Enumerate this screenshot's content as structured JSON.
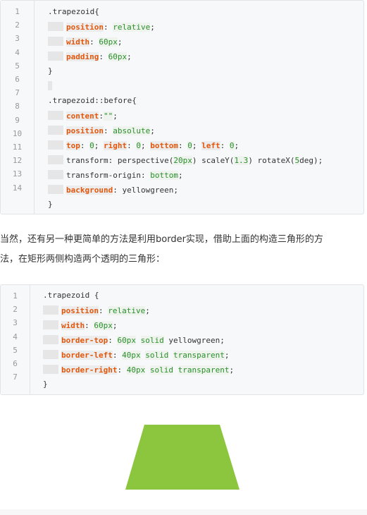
{
  "block1": {
    "line_numbers": [
      "1",
      "2",
      "3",
      "4",
      "5",
      "6",
      "7",
      "8",
      "9",
      "10",
      "11",
      "12",
      "13",
      "14"
    ],
    "lines": [
      [
        {
          "t": "plain",
          "v": ".trapezoid{"
        }
      ],
      [
        {
          "t": "prop",
          "v": "position"
        },
        {
          "t": "plain",
          "v": ": "
        },
        {
          "t": "val",
          "v": "relative"
        },
        {
          "t": "plain",
          "v": ";"
        }
      ],
      [
        {
          "t": "prop",
          "v": "width"
        },
        {
          "t": "plain",
          "v": ": "
        },
        {
          "t": "val",
          "v": "60px"
        },
        {
          "t": "plain",
          "v": ";"
        }
      ],
      [
        {
          "t": "prop",
          "v": "padding"
        },
        {
          "t": "plain",
          "v": ": "
        },
        {
          "t": "val",
          "v": "60px"
        },
        {
          "t": "plain",
          "v": ";"
        }
      ],
      [
        {
          "t": "plain",
          "v": "}"
        }
      ],
      [],
      [
        {
          "t": "plain",
          "v": ".trapezoid::before{"
        }
      ],
      [
        {
          "t": "prop",
          "v": "content"
        },
        {
          "t": "plain",
          "v": ":"
        },
        {
          "t": "val",
          "v": "\"\""
        },
        {
          "t": "plain",
          "v": ";"
        }
      ],
      [
        {
          "t": "prop",
          "v": "position"
        },
        {
          "t": "plain",
          "v": ": "
        },
        {
          "t": "val",
          "v": "absolute"
        },
        {
          "t": "plain",
          "v": ";"
        }
      ],
      [
        {
          "t": "prop",
          "v": "top"
        },
        {
          "t": "plain",
          "v": ": "
        },
        {
          "t": "val",
          "v": "0"
        },
        {
          "t": "plain",
          "v": "; "
        },
        {
          "t": "prop",
          "v": "right"
        },
        {
          "t": "plain",
          "v": ": "
        },
        {
          "t": "val",
          "v": "0"
        },
        {
          "t": "plain",
          "v": "; "
        },
        {
          "t": "prop",
          "v": "bottom"
        },
        {
          "t": "plain",
          "v": ": "
        },
        {
          "t": "val",
          "v": "0"
        },
        {
          "t": "plain",
          "v": "; "
        },
        {
          "t": "prop",
          "v": "left"
        },
        {
          "t": "plain",
          "v": ": "
        },
        {
          "t": "val",
          "v": "0"
        },
        {
          "t": "plain",
          "v": ";"
        }
      ],
      [
        {
          "t": "plain",
          "v": "transform: perspective("
        },
        {
          "t": "val",
          "v": "20px"
        },
        {
          "t": "plain",
          "v": ") scaleY("
        },
        {
          "t": "val",
          "v": "1.3"
        },
        {
          "t": "plain",
          "v": ") rotateX("
        },
        {
          "t": "val",
          "v": "5"
        },
        {
          "t": "plain",
          "v": "deg);"
        }
      ],
      [
        {
          "t": "plain",
          "v": "transform-origin: "
        },
        {
          "t": "val",
          "v": "bottom"
        },
        {
          "t": "plain",
          "v": ";"
        }
      ],
      [
        {
          "t": "prop",
          "v": "background"
        },
        {
          "t": "plain",
          "v": ": yellowgreen;"
        }
      ],
      [
        {
          "t": "plain",
          "v": "}"
        }
      ]
    ],
    "indented": [
      false,
      true,
      true,
      true,
      false,
      false,
      false,
      true,
      true,
      true,
      true,
      true,
      true,
      false
    ]
  },
  "paragraph": {
    "line1": "当然，还有另一种更简单的方法是利用border实现，借助上面的构造三角形的方",
    "line2": "法，在矩形两侧构造两个透明的三角形："
  },
  "block2": {
    "line_numbers": [
      "1",
      "2",
      "3",
      "4",
      "5",
      "6",
      "7"
    ],
    "lines": [
      [
        {
          "t": "plain",
          "v": ".trapezoid {"
        }
      ],
      [
        {
          "t": "prop",
          "v": "position"
        },
        {
          "t": "plain",
          "v": ": "
        },
        {
          "t": "val",
          "v": "relative"
        },
        {
          "t": "plain",
          "v": ";"
        }
      ],
      [
        {
          "t": "prop",
          "v": "width"
        },
        {
          "t": "plain",
          "v": ": "
        },
        {
          "t": "val",
          "v": "60px"
        },
        {
          "t": "plain",
          "v": ";"
        }
      ],
      [
        {
          "t": "prop",
          "v": "border-top"
        },
        {
          "t": "plain",
          "v": ": "
        },
        {
          "t": "val",
          "v": "60px"
        },
        {
          "t": "plain",
          "v": " "
        },
        {
          "t": "val",
          "v": "solid"
        },
        {
          "t": "plain",
          "v": " yellowgreen;"
        }
      ],
      [
        {
          "t": "prop",
          "v": "border-left"
        },
        {
          "t": "plain",
          "v": ": "
        },
        {
          "t": "val",
          "v": "40px"
        },
        {
          "t": "plain",
          "v": " "
        },
        {
          "t": "val",
          "v": "solid"
        },
        {
          "t": "plain",
          "v": " "
        },
        {
          "t": "val",
          "v": "transparent"
        },
        {
          "t": "plain",
          "v": ";"
        }
      ],
      [
        {
          "t": "prop",
          "v": "border-right"
        },
        {
          "t": "plain",
          "v": ": "
        },
        {
          "t": "val",
          "v": "40px"
        },
        {
          "t": "plain",
          "v": " "
        },
        {
          "t": "val",
          "v": "solid"
        },
        {
          "t": "plain",
          "v": " "
        },
        {
          "t": "val",
          "v": "transparent"
        },
        {
          "t": "plain",
          "v": ";"
        }
      ],
      [
        {
          "t": "plain",
          "v": "}"
        }
      ]
    ],
    "indented": [
      false,
      true,
      true,
      true,
      true,
      true,
      false
    ]
  },
  "trapezoid_color": "#8cc63f"
}
